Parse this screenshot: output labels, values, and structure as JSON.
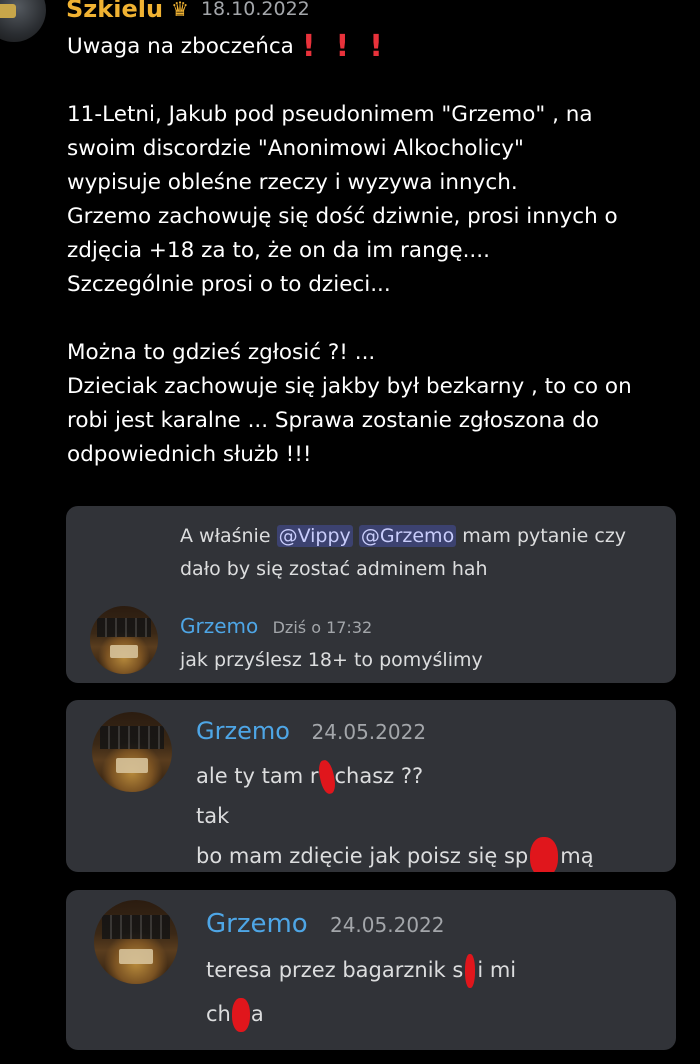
{
  "post": {
    "username": "Szkielu",
    "timestamp": "18.10.2022",
    "title": "Uwaga na zboczeńca",
    "body_1": "11-Letni, Jakub pod pseudonimem \"Grzemo\" , na\nswoim discordzie \"Anonimowi  Alkocholicy\"\nwypisuje obleśne rzeczy i wyzywa innych.\nGrzemo zachowuję się dość dziwnie, prosi innych o\nzdjęcia +18 za to, że on da im rangę....\nSzczególnie prosi o to dzieci...",
    "body_2": "Można to gdzieś zgłosić ?! ...\nDzieciak zachowuje się jakby był bezkarny , to co on\nrobi jest karalne ... Sprawa zostanie zgłoszona do\nodpowiednich służb !!!",
    "exclamations": [
      "!",
      "!",
      "!"
    ]
  },
  "screenshot_1": {
    "reply_prefix": "A właśnie ",
    "mention_1": "@Vippy",
    "mention_2": "@Grzemo",
    "reply_suffix_1": " mam pytanie czy",
    "reply_suffix_2": "dało by się zostać adminem hah",
    "author": "Grzemo",
    "timestamp": "Dziś o 17:32",
    "message": "jak przyślesz 18+ to pomyślimy"
  },
  "screenshot_2": {
    "author": "Grzemo",
    "timestamp": "24.05.2022",
    "line_1_a": "ale ty tam r",
    "line_1_b": "chasz ??",
    "line_2": "tak",
    "line_3_a": "bo mam zdięcie jak poisz się sp",
    "line_3_b": "mą"
  },
  "screenshot_3": {
    "author": "Grzemo",
    "timestamp": "24.05.2022",
    "line_1_a": "teresa przez bagarznik s",
    "line_1_b": "i mi",
    "line_2_a": "ch",
    "line_2_b": "a"
  },
  "colors": {
    "background": "#000000",
    "card_bg": "#313338",
    "username_gold": "#f0b232",
    "author_blue": "#4ea6e6",
    "redaction_red": "#e0161c",
    "exclamation_red": "#e8323b"
  },
  "icons": {
    "crown": "crown-icon"
  }
}
